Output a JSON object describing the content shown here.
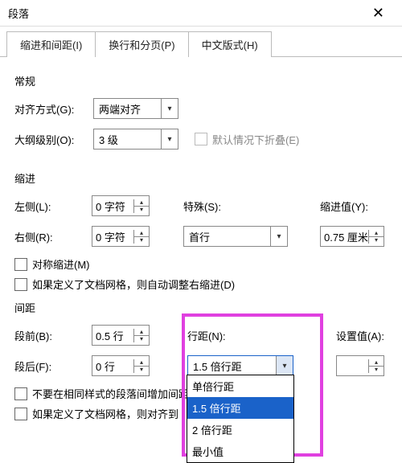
{
  "window": {
    "title": "段落"
  },
  "tabs": [
    {
      "label": "缩进和间距(I)"
    },
    {
      "label": "换行和分页(P)"
    },
    {
      "label": "中文版式(H)"
    }
  ],
  "sections": {
    "general": "常规",
    "indent": "缩进",
    "spacing": "间距"
  },
  "general": {
    "align_label": "对齐方式(G):",
    "align_value": "两端对齐",
    "outline_label": "大纲级别(O):",
    "outline_value": "3 级",
    "collapse_label": "默认情况下折叠(E)"
  },
  "indent": {
    "left_label": "左侧(L):",
    "left_value": "0 字符",
    "right_label": "右侧(R):",
    "right_value": "0 字符",
    "special_label": "特殊(S):",
    "special_value": "首行",
    "by_label": "缩进值(Y):",
    "by_value": "0.75 厘米",
    "mirror_label": "对称缩进(M)",
    "grid_label": "如果定义了文档网格，则自动调整右缩进(D)"
  },
  "spacing": {
    "before_label": "段前(B):",
    "before_value": "0.5 行",
    "after_label": "段后(F):",
    "after_value": "0 行",
    "line_label": "行距(N):",
    "line_value": "1.5 倍行距",
    "at_label": "设置值(A):",
    "at_value": "",
    "noaddspace_label": "不要在相同样式的段落间增加间距",
    "snapgrid_label": "如果定义了文档网格，则对齐到"
  },
  "line_spacing_options": [
    "单倍行距",
    "1.5 倍行距",
    "2 倍行距",
    "最小值"
  ]
}
